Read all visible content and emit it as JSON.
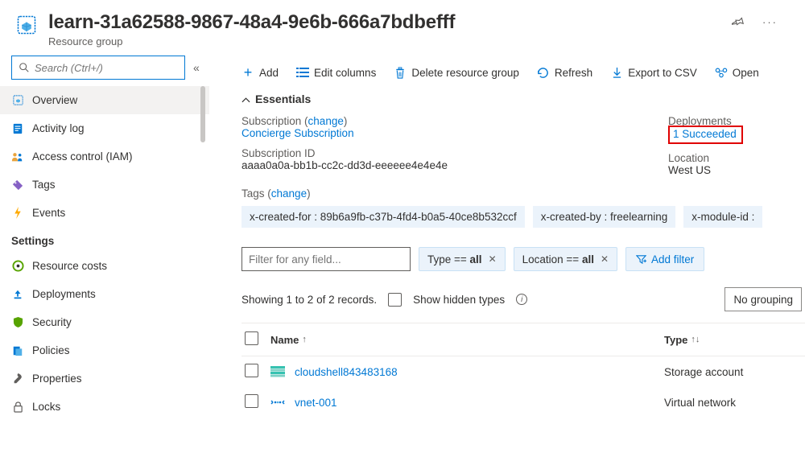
{
  "header": {
    "title": "learn-31a62588-9867-48a4-9e6b-666a7bdbefff",
    "subtitle": "Resource group"
  },
  "sidebar": {
    "search_placeholder": "Search (Ctrl+/)",
    "items": [
      {
        "label": "Overview",
        "icon": "cube-icon",
        "active": true
      },
      {
        "label": "Activity log",
        "icon": "log-icon"
      },
      {
        "label": "Access control (IAM)",
        "icon": "people-icon"
      },
      {
        "label": "Tags",
        "icon": "tag-icon"
      },
      {
        "label": "Events",
        "icon": "lightning-icon"
      }
    ],
    "settings_label": "Settings",
    "settings": [
      {
        "label": "Resource costs",
        "icon": "gauge-icon"
      },
      {
        "label": "Deployments",
        "icon": "upload-icon"
      },
      {
        "label": "Security",
        "icon": "shield-icon"
      },
      {
        "label": "Policies",
        "icon": "policy-icon"
      },
      {
        "label": "Properties",
        "icon": "wrench-icon"
      },
      {
        "label": "Locks",
        "icon": "lock-icon"
      }
    ]
  },
  "toolbar": {
    "add": "Add",
    "edit_columns": "Edit columns",
    "delete": "Delete resource group",
    "refresh": "Refresh",
    "export": "Export to CSV",
    "open": "Open"
  },
  "essentials": {
    "header": "Essentials",
    "subscription_label": "Subscription",
    "change": "change",
    "subscription_value": "Concierge Subscription",
    "subid_label": "Subscription ID",
    "subid_value": "aaaa0a0a-bb1b-cc2c-dd3d-eeeeee4e4e4e",
    "deployments_label": "Deployments",
    "deployments_value": "1 Succeeded",
    "location_label": "Location",
    "location_value": "West US",
    "tags_label": "Tags",
    "tags": [
      "x-created-for : 89b6a9fb-c37b-4fd4-b0a5-40ce8b532ccf",
      "x-created-by : freelearning",
      "x-module-id :"
    ]
  },
  "filters": {
    "placeholder": "Filter for any field...",
    "type_prefix": "Type == ",
    "type_value": "all",
    "location_prefix": "Location == ",
    "location_value": "all",
    "add_filter": "Add filter"
  },
  "listmeta": {
    "showing": "Showing 1 to 2 of 2 records.",
    "hidden": "Show hidden types",
    "nogroup": "No grouping"
  },
  "table": {
    "name_header": "Name",
    "type_header": "Type",
    "rows": [
      {
        "name": "cloudshell843483168",
        "type": "Storage account",
        "icon": "storage"
      },
      {
        "name": "vnet-001",
        "type": "Virtual network",
        "icon": "vnet"
      }
    ]
  }
}
